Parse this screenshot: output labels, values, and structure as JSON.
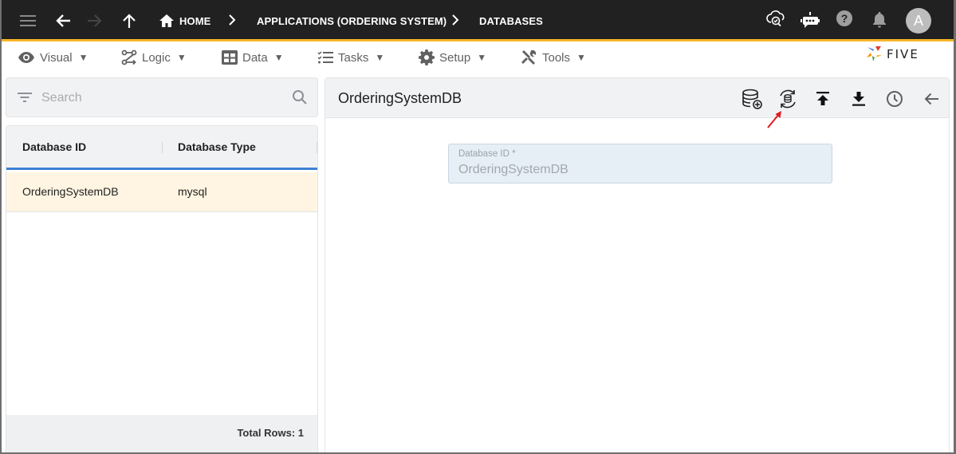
{
  "appbar": {
    "breadcrumbs": [
      "HOME",
      "APPLICATIONS (ORDERING SYSTEM)",
      "DATABASES"
    ],
    "avatar_initial": "A",
    "icons": [
      "menu-icon",
      "back-arrow-icon",
      "forward-arrow-icon",
      "up-arrow-icon",
      "home-icon",
      "cloud-check-icon",
      "chatbot-icon",
      "help-icon",
      "bell-icon"
    ],
    "colors": {
      "background": "#212121",
      "accent": "#f7b52b"
    }
  },
  "menubar": {
    "items": [
      {
        "label": "Visual",
        "icon": "eye-icon"
      },
      {
        "label": "Logic",
        "icon": "flow-icon"
      },
      {
        "label": "Data",
        "icon": "table-icon"
      },
      {
        "label": "Tasks",
        "icon": "checklist-icon"
      },
      {
        "label": "Setup",
        "icon": "gear-icon"
      },
      {
        "label": "Tools",
        "icon": "tools-icon"
      }
    ],
    "caret": "▼",
    "logo_text": "FIVE"
  },
  "left_panel": {
    "search": {
      "placeholder": "Search",
      "value": ""
    },
    "columns": [
      "Database ID",
      "Database Type"
    ],
    "rows": [
      {
        "database_id": "OrderingSystemDB",
        "database_type": "mysql"
      }
    ],
    "footer": "Total Rows: 1"
  },
  "right_panel": {
    "title": "OrderingSystemDB",
    "toolbar": [
      "database-add-icon",
      "database-sync-icon",
      "upload-icon",
      "download-icon",
      "history-icon",
      "back-arrow-icon"
    ],
    "fields": [
      {
        "label": "Database ID *",
        "value": "OrderingSystemDB"
      }
    ]
  }
}
